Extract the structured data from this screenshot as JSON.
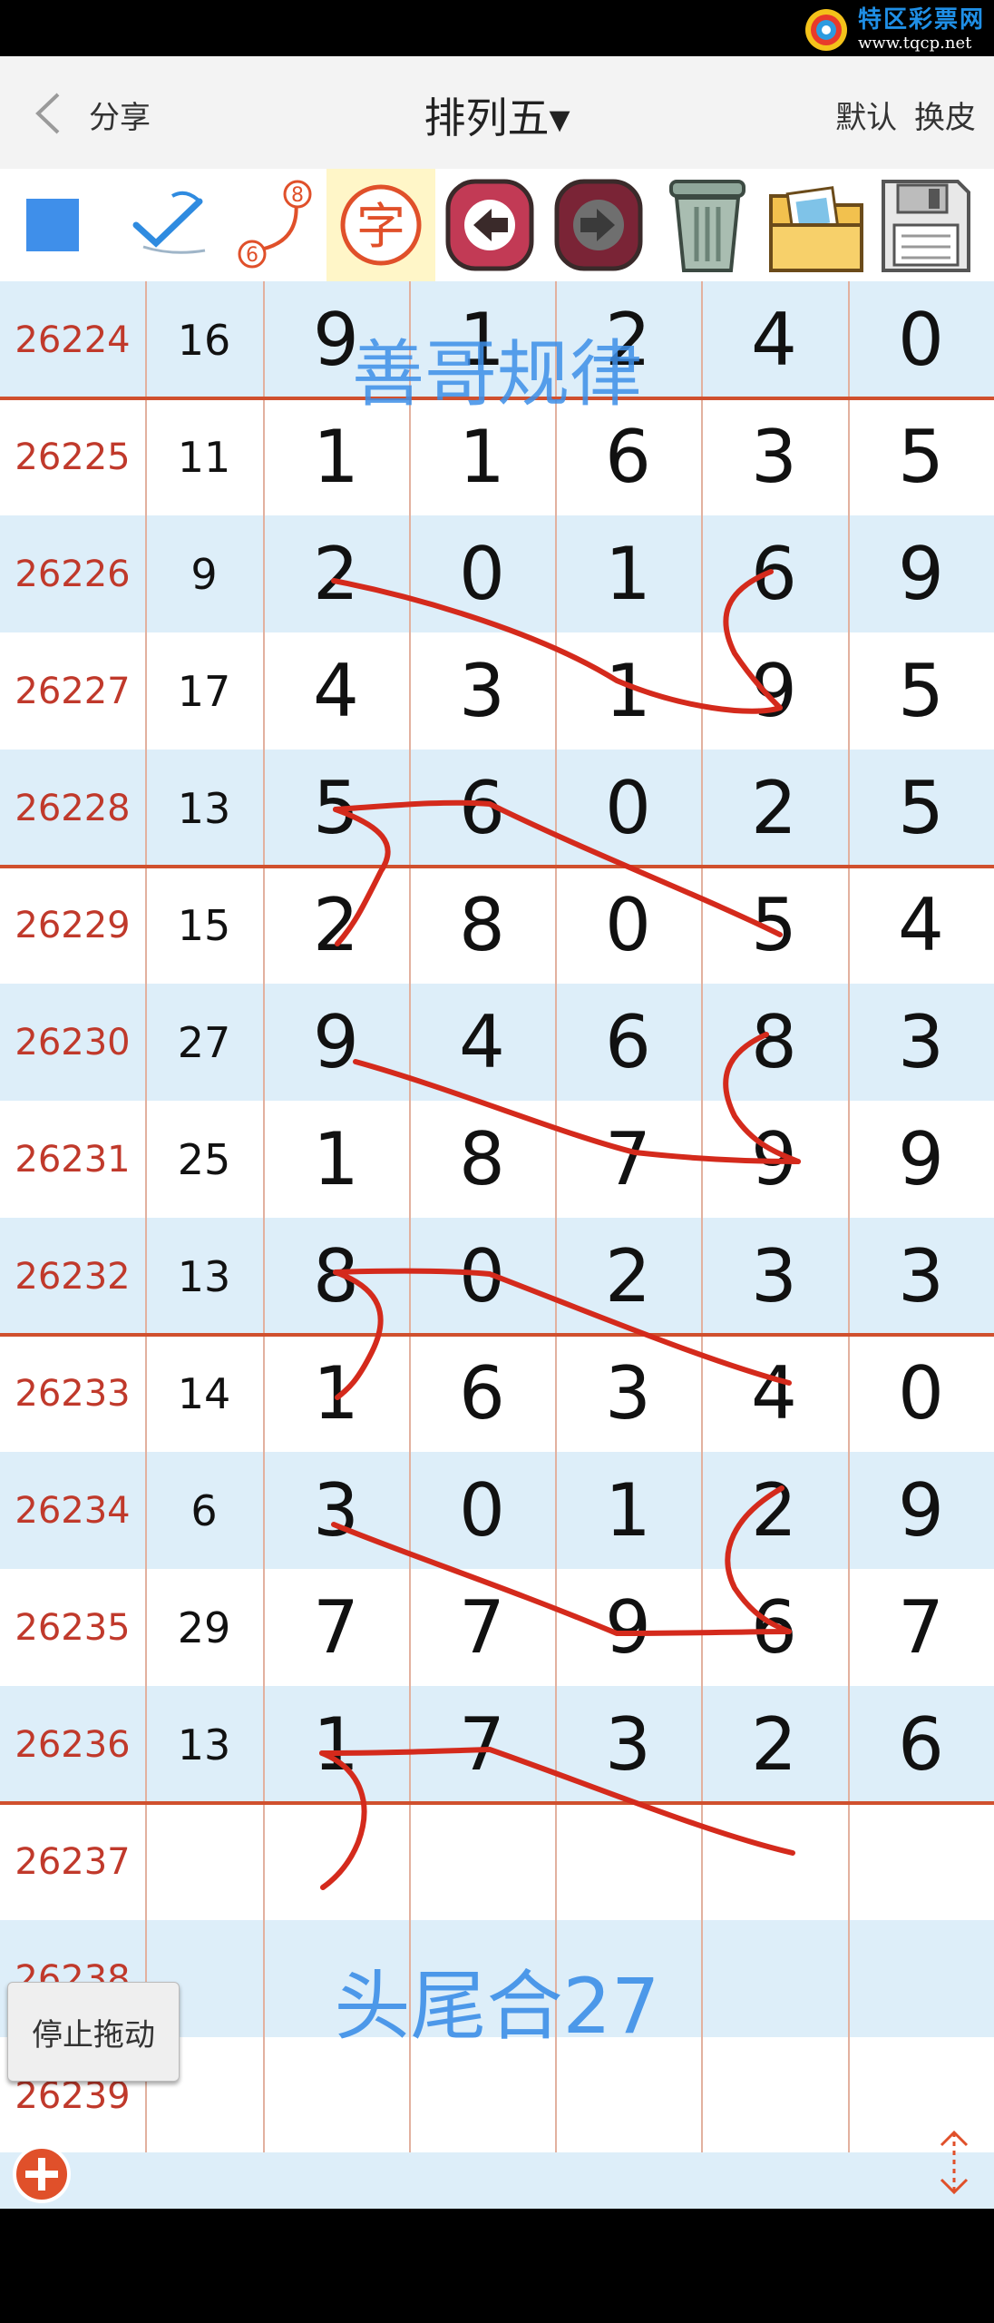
{
  "watermark": {
    "text": "特区彩票网",
    "url": "www.tqcp.net"
  },
  "header": {
    "share": "分享",
    "title": "排列五▾",
    "right_actions": "默认 换皮"
  },
  "toolbar": {
    "icons": [
      "square-icon",
      "check-pen-icon",
      "curve-6-8-icon",
      "zi-char-icon",
      "arrow-left-icon",
      "arrow-right-icon",
      "trash-icon",
      "picture-folder-icon",
      "save-disk-icon"
    ]
  },
  "overlays": {
    "top": "善哥规律",
    "bottom": "头尾合27"
  },
  "float_button": {
    "label": "停止拖动"
  },
  "colors": {
    "row_blue": "#ddeef9",
    "row_white": "#ffffff",
    "issue_red": "#c0392b",
    "separator": "#d0502e",
    "pen_red": "#d42a1c",
    "overlay_blue": "#3d8fe8"
  },
  "rows": [
    {
      "issue": "26224",
      "sum": "16",
      "digits": [
        "9",
        "1",
        "2",
        "4",
        "0"
      ]
    },
    {
      "issue": "26225",
      "sum": "11",
      "digits": [
        "1",
        "1",
        "6",
        "3",
        "5"
      ]
    },
    {
      "issue": "26226",
      "sum": "9",
      "digits": [
        "2",
        "0",
        "1",
        "6",
        "9"
      ]
    },
    {
      "issue": "26227",
      "sum": "17",
      "digits": [
        "4",
        "3",
        "1",
        "9",
        "5"
      ]
    },
    {
      "issue": "26228",
      "sum": "13",
      "digits": [
        "5",
        "6",
        "0",
        "2",
        "5"
      ]
    },
    {
      "issue": "26229",
      "sum": "15",
      "digits": [
        "2",
        "8",
        "0",
        "5",
        "4"
      ]
    },
    {
      "issue": "26230",
      "sum": "27",
      "digits": [
        "9",
        "4",
        "6",
        "8",
        "3"
      ]
    },
    {
      "issue": "26231",
      "sum": "25",
      "digits": [
        "1",
        "8",
        "7",
        "9",
        "9"
      ]
    },
    {
      "issue": "26232",
      "sum": "13",
      "digits": [
        "8",
        "0",
        "2",
        "3",
        "3"
      ]
    },
    {
      "issue": "26233",
      "sum": "14",
      "digits": [
        "1",
        "6",
        "3",
        "4",
        "0"
      ]
    },
    {
      "issue": "26234",
      "sum": "6",
      "digits": [
        "3",
        "0",
        "1",
        "2",
        "9"
      ]
    },
    {
      "issue": "26235",
      "sum": "29",
      "digits": [
        "7",
        "7",
        "9",
        "6",
        "7"
      ]
    },
    {
      "issue": "26236",
      "sum": "13",
      "digits": [
        "1",
        "7",
        "3",
        "2",
        "6"
      ]
    },
    {
      "issue": "26237",
      "sum": "",
      "digits": [
        "",
        "",
        "",
        "",
        ""
      ]
    },
    {
      "issue": "26238",
      "sum": "",
      "digits": [
        "",
        "",
        "",
        "",
        ""
      ]
    },
    {
      "issue": "26239",
      "sum": "",
      "digits": [
        "",
        "",
        "",
        "",
        ""
      ]
    }
  ]
}
